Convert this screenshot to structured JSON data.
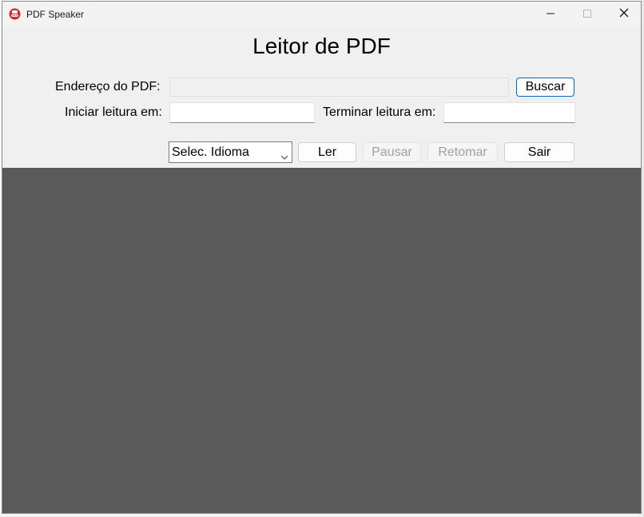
{
  "window": {
    "title": "PDF Speaker",
    "icon": "red-app-icon"
  },
  "controls": {
    "minimize": "minimize-icon",
    "maximize": "maximize-icon",
    "close": "close-icon"
  },
  "main": {
    "heading": "Leitor de PDF",
    "address_label": "Endereço do PDF:",
    "address_value": "",
    "search_button": "Buscar",
    "start_label": "Iniciar leitura em:",
    "start_value": "",
    "end_label": "Terminar leitura em:",
    "end_value": ""
  },
  "actions": {
    "language_select": "Selec. Idioma",
    "read_button": "Ler",
    "pause_button": "Pausar",
    "resume_button": "Retomar",
    "exit_button": "Sair"
  },
  "colors": {
    "accent": "#0067c0",
    "panel": "#5a5a5a",
    "icon_red": "#d42a2a"
  }
}
